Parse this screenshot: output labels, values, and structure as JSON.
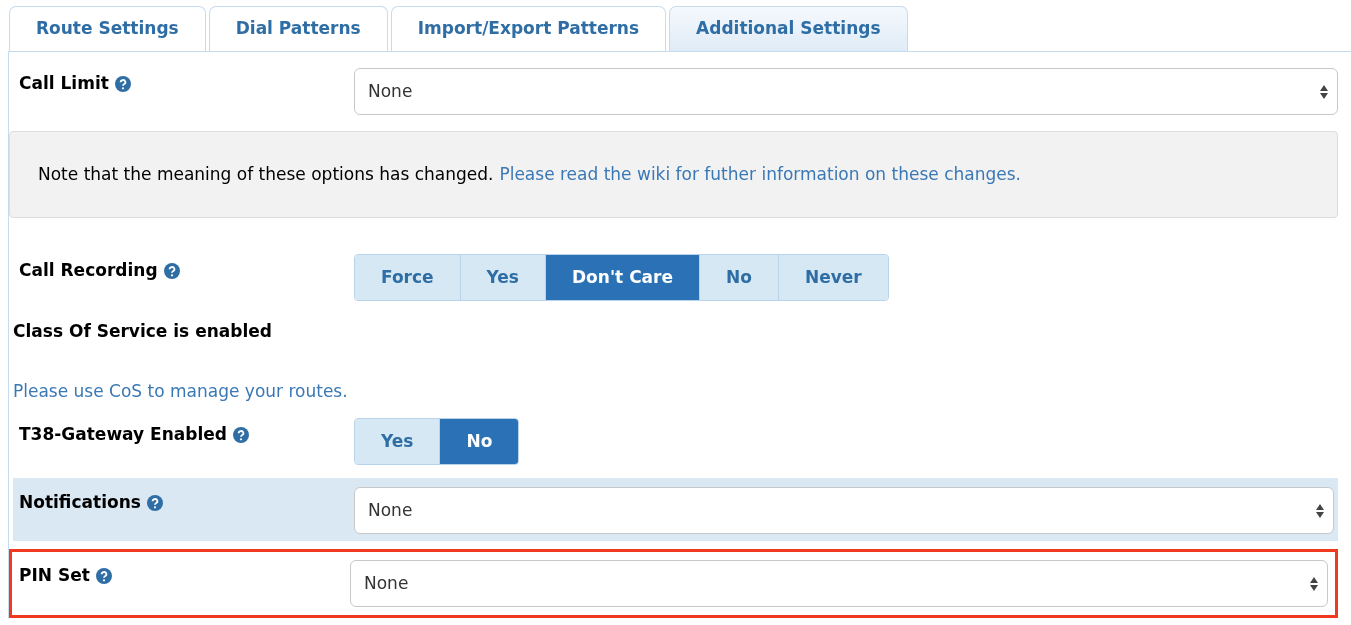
{
  "tabs": [
    {
      "label": "Route Settings",
      "selected": false
    },
    {
      "label": "Dial Patterns",
      "selected": false
    },
    {
      "label": "Import/Export Patterns",
      "selected": false
    },
    {
      "label": "Additional Settings",
      "selected": true
    }
  ],
  "rows": [
    {
      "kind": "select",
      "label": "Call Limit",
      "value": "None"
    },
    {
      "kind": "note",
      "text": "Note that the meaning of these options has changed.",
      "link": "Please read the wiki for futher information on these changes."
    },
    {
      "kind": "toggle",
      "label": "Call Recording",
      "options": [
        {
          "label": "Force",
          "selected": false
        },
        {
          "label": "Yes",
          "selected": false
        },
        {
          "label": "Don't Care",
          "selected": true
        },
        {
          "label": "No",
          "selected": false
        },
        {
          "label": "Never",
          "selected": false
        }
      ]
    },
    {
      "kind": "heading",
      "text": "Class Of Service is enabled"
    },
    {
      "kind": "link",
      "text": "Please use CoS to manage your routes."
    },
    {
      "kind": "toggle",
      "label": "T38-Gateway Enabled",
      "options": [
        {
          "label": "Yes",
          "selected": false
        },
        {
          "label": "No",
          "selected": true
        }
      ]
    },
    {
      "kind": "select",
      "label": "Notifications",
      "value": "None",
      "highlighted": true
    },
    {
      "kind": "select",
      "label": "PIN Set",
      "value": "None",
      "outlined": true
    }
  ]
}
